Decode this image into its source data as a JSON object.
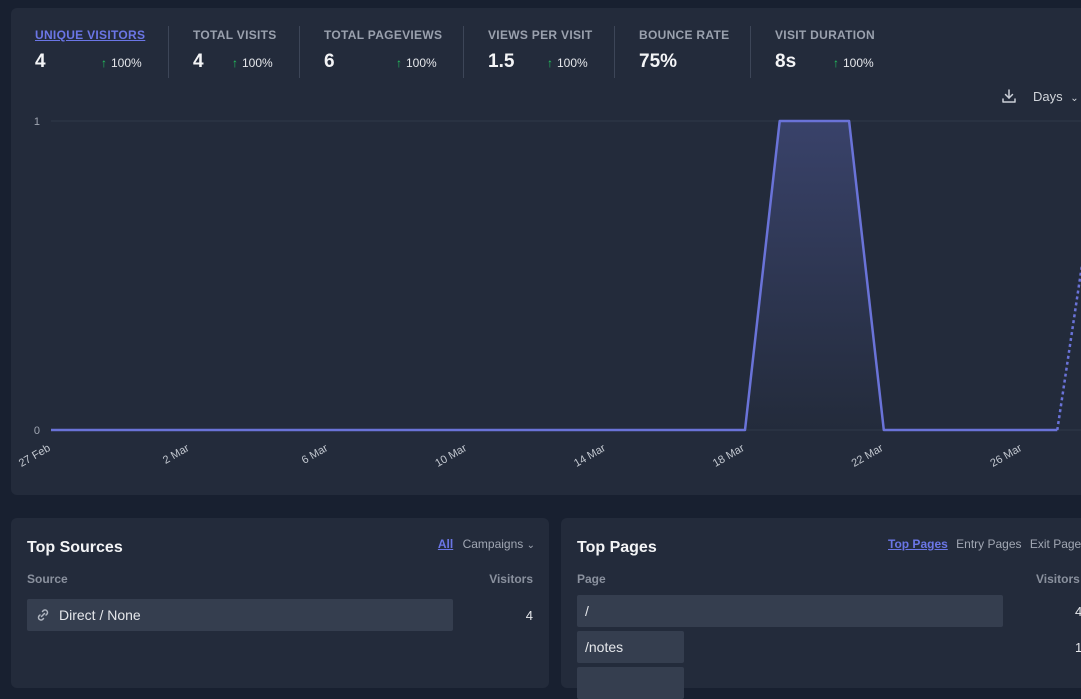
{
  "stats": [
    {
      "label": "UNIQUE VISITORS",
      "value": "4",
      "change": "100%",
      "active": true
    },
    {
      "label": "TOTAL VISITS",
      "value": "4",
      "change": "100%"
    },
    {
      "label": "TOTAL PAGEVIEWS",
      "value": "6",
      "change": "100%"
    },
    {
      "label": "VIEWS PER VISIT",
      "value": "1.5",
      "change": "100%"
    },
    {
      "label": "BOUNCE RATE",
      "value": "75%",
      "change": ""
    },
    {
      "label": "VISIT DURATION",
      "value": "8s",
      "change": "100%"
    }
  ],
  "chart_controls": {
    "interval": "Days",
    "download_icon": "download-icon",
    "chevron_icon": "chevron-down-icon"
  },
  "colors": {
    "accent": "#6b76e6",
    "line": "#6a73d8",
    "positive": "#22c55e",
    "card": "#232b3b",
    "background": "#182030"
  },
  "chart_data": {
    "type": "area",
    "title": "",
    "xlabel": "",
    "ylabel": "",
    "ylim": [
      0,
      1
    ],
    "y_ticks": [
      "0",
      "1"
    ],
    "x_ticks": [
      "27 Feb",
      "2 Mar",
      "6 Mar",
      "10 Mar",
      "14 Mar",
      "18 Mar",
      "22 Mar",
      "26 Mar"
    ],
    "grid": true,
    "series": [
      {
        "values": [
          0,
          0,
          0,
          0,
          0,
          0,
          0,
          0,
          0,
          0,
          0,
          0,
          0,
          0,
          0,
          0,
          0,
          0,
          0,
          0,
          0,
          1,
          1,
          1,
          0,
          0,
          0,
          0,
          0,
          0,
          0.75
        ],
        "dashed_from_index": 29
      }
    ]
  },
  "top_sources": {
    "title": "Top Sources",
    "tabs": [
      "All",
      "Campaigns"
    ],
    "active_tab": "All",
    "columns": [
      "Source",
      "Visitors"
    ],
    "rows": [
      {
        "label": "Direct / None",
        "value": "4",
        "icon": "link-icon",
        "share": 1.0
      }
    ]
  },
  "top_pages": {
    "title": "Top Pages",
    "tabs": [
      "Top Pages",
      "Entry Pages",
      "Exit Pages"
    ],
    "active_tab": "Top Pages",
    "columns": [
      "Page",
      "Visitors"
    ],
    "rows": [
      {
        "label": "/",
        "value": "4",
        "share": 1.0
      },
      {
        "label": "/notes",
        "value": "1",
        "share": 0.25
      },
      {
        "label": "",
        "value": "",
        "share": 0.25
      }
    ]
  }
}
